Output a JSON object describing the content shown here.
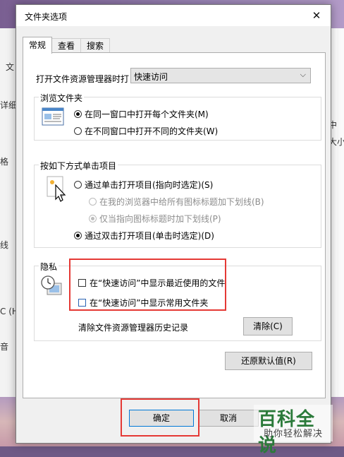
{
  "window": {
    "title": "文件夹选项",
    "close": "✕"
  },
  "tabs": [
    {
      "label": "常规",
      "active": true
    },
    {
      "label": "查看",
      "active": false
    },
    {
      "label": "搜索",
      "active": false
    }
  ],
  "open_explorer": {
    "label": "打开文件资源管理器时打",
    "value": "快速访问"
  },
  "browse_group": {
    "title": "浏览文件夹",
    "options": [
      {
        "label": "在同一窗口中打开每个文件夹(M)",
        "selected": true
      },
      {
        "label": "在不同窗口中打开不同的文件夹(W)",
        "selected": false
      }
    ]
  },
  "click_group": {
    "title": "按如下方式单击项目",
    "options": [
      {
        "label": "通过单击打开项目(指向时选定)(S)",
        "selected": false,
        "enabled": true
      },
      {
        "label": "在我的浏览器中给所有图标标题加下划线(B)",
        "selected": false,
        "enabled": false
      },
      {
        "label": "仅当指向图标标题时加下划线(P)",
        "selected": true,
        "enabled": false
      },
      {
        "label": "通过双击打开项目(单击时选定)(D)",
        "selected": true,
        "enabled": true
      }
    ]
  },
  "privacy_group": {
    "title": "隐私",
    "checks": [
      {
        "label": "在“快速访问”中显示最近使用的文件",
        "checked": false
      },
      {
        "label": "在“快速访问”中显示常用文件夹",
        "checked": false
      }
    ],
    "clear_label": "清除文件资源管理器历史记录",
    "clear_button": "清除(C)"
  },
  "restore_button": "还原默认值(R)",
  "ok_button": "确定",
  "cancel_button": "取消",
  "background_fragments": [
    "文",
    "详细",
    "格",
    "线",
    "C (H:",
    "音",
    "中",
    "大小"
  ],
  "watermark": {
    "big": "百科全说",
    "small": "助你轻松解决"
  },
  "colors": {
    "highlight": "#e53935",
    "focus": "#0078d7",
    "watermark": "#2b7a3a"
  }
}
